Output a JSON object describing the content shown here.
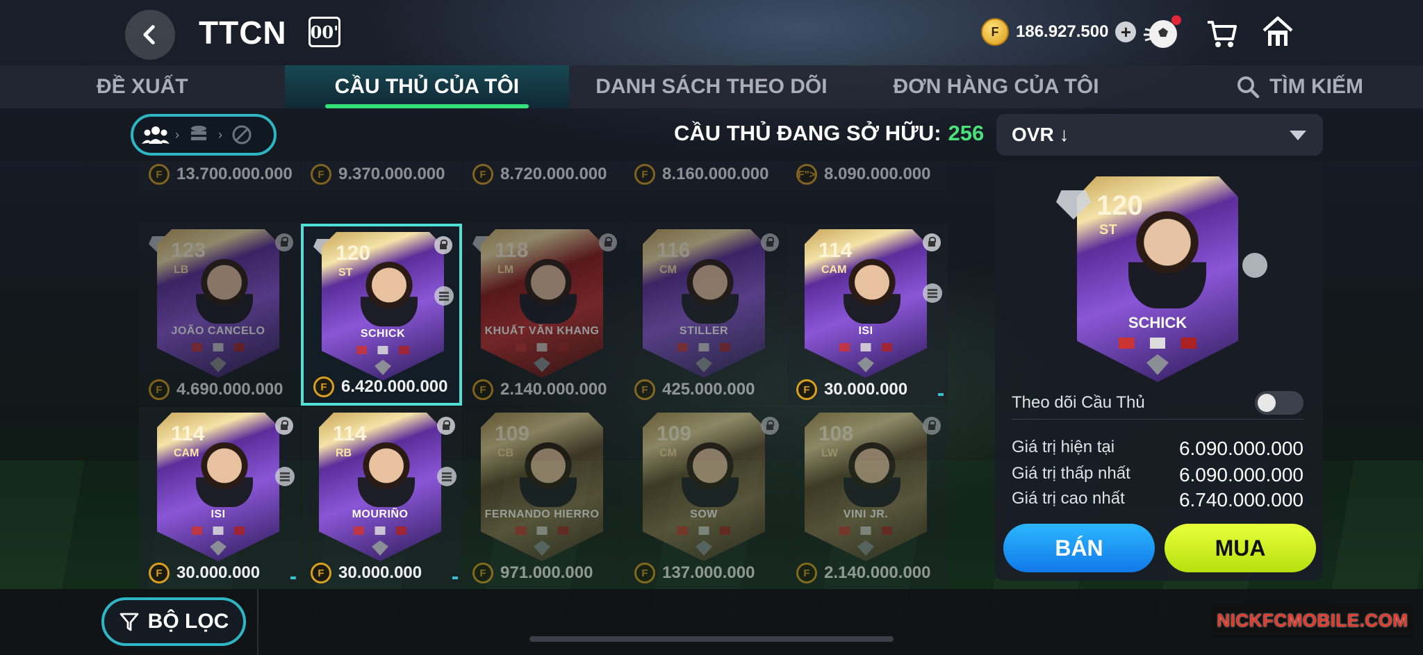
{
  "header": {
    "title": "TTCN",
    "season_badge": "00'",
    "coins": "186.927.500"
  },
  "tabs": [
    {
      "label": "ĐỀ XUẤT",
      "active": false
    },
    {
      "label": "CẦU THỦ CỦA TÔI",
      "active": true
    },
    {
      "label": "DANH SÁCH THEO DÕI",
      "active": false
    },
    {
      "label": "ĐƠN HÀNG CỦA TÔI",
      "active": false
    },
    {
      "label": "TÌM KIẾM",
      "active": false,
      "icon": "search-icon"
    }
  ],
  "subbar": {
    "owned_label": "CẦU THỦ ĐANG SỞ HỮU:",
    "owned_count": "256",
    "sort_label": "OVR ↓"
  },
  "grid": {
    "top_prices": [
      "13.700.000.000",
      "9.370.000.000",
      "8.720.000.000",
      "8.160.000.000",
      "8.090.000.000"
    ],
    "row1": [
      {
        "ovr": "123",
        "pos": "LB",
        "name": "JOÃO CANCELO",
        "price": "4.690.000.000",
        "style": "purple",
        "dim": true
      },
      {
        "ovr": "120",
        "pos": "ST",
        "name": "SCHICK",
        "price": "6.420.000.000",
        "style": "purple",
        "dim": false,
        "selected": true
      },
      {
        "ovr": "118",
        "pos": "LM",
        "name": "KHUẤT VĂN KHANG",
        "price": "2.140.000.000",
        "style": "red",
        "dim": true
      },
      {
        "ovr": "116",
        "pos": "CM",
        "name": "STILLER",
        "price": "425.000.000",
        "style": "purple",
        "dim": true
      },
      {
        "ovr": "114",
        "pos": "CAM",
        "name": "ISI",
        "price": "30.000.000",
        "style": "purple",
        "dim": false
      }
    ],
    "row2": [
      {
        "ovr": "114",
        "pos": "CAM",
        "name": "ISI",
        "price": "30.000.000",
        "style": "purple",
        "dim": false
      },
      {
        "ovr": "114",
        "pos": "RB",
        "name": "MOURIÑO",
        "price": "30.000.000",
        "style": "purple",
        "dim": false
      },
      {
        "ovr": "109",
        "pos": "CB",
        "name": "FERNANDO HIERRO",
        "price": "971.000.000",
        "style": "gold",
        "dim": true
      },
      {
        "ovr": "109",
        "pos": "CM",
        "name": "SOW",
        "price": "137.000.000",
        "style": "gold",
        "dim": true
      },
      {
        "ovr": "108",
        "pos": "LW",
        "name": "VINI JR.",
        "price": "2.140.000.000",
        "style": "gold",
        "dim": true
      }
    ]
  },
  "detail": {
    "ovr": "120",
    "pos": "ST",
    "name": "SCHICK",
    "follow_label": "Theo dõi Cầu Thủ",
    "follow_on": false,
    "current_label": "Giá trị hiện tại",
    "current_value": "6.090.000.000",
    "min_label": "Giá trị thấp nhất",
    "min_value": "6.090.000.000",
    "max_label": "Giá trị cao nhất",
    "max_value": "6.740.000.000",
    "sell_label": "BÁN",
    "buy_label": "MUA"
  },
  "bottom": {
    "filter_label": "BỘ LỌC",
    "watermark": "NICKFCMOBILE.COM"
  },
  "colors": {
    "accent_green": "#33e07a",
    "owned_count": "#4be07a",
    "selected_border": "#4fe0d8",
    "sell_button": "#1f9cf5",
    "buy_button": "#d4f523"
  }
}
